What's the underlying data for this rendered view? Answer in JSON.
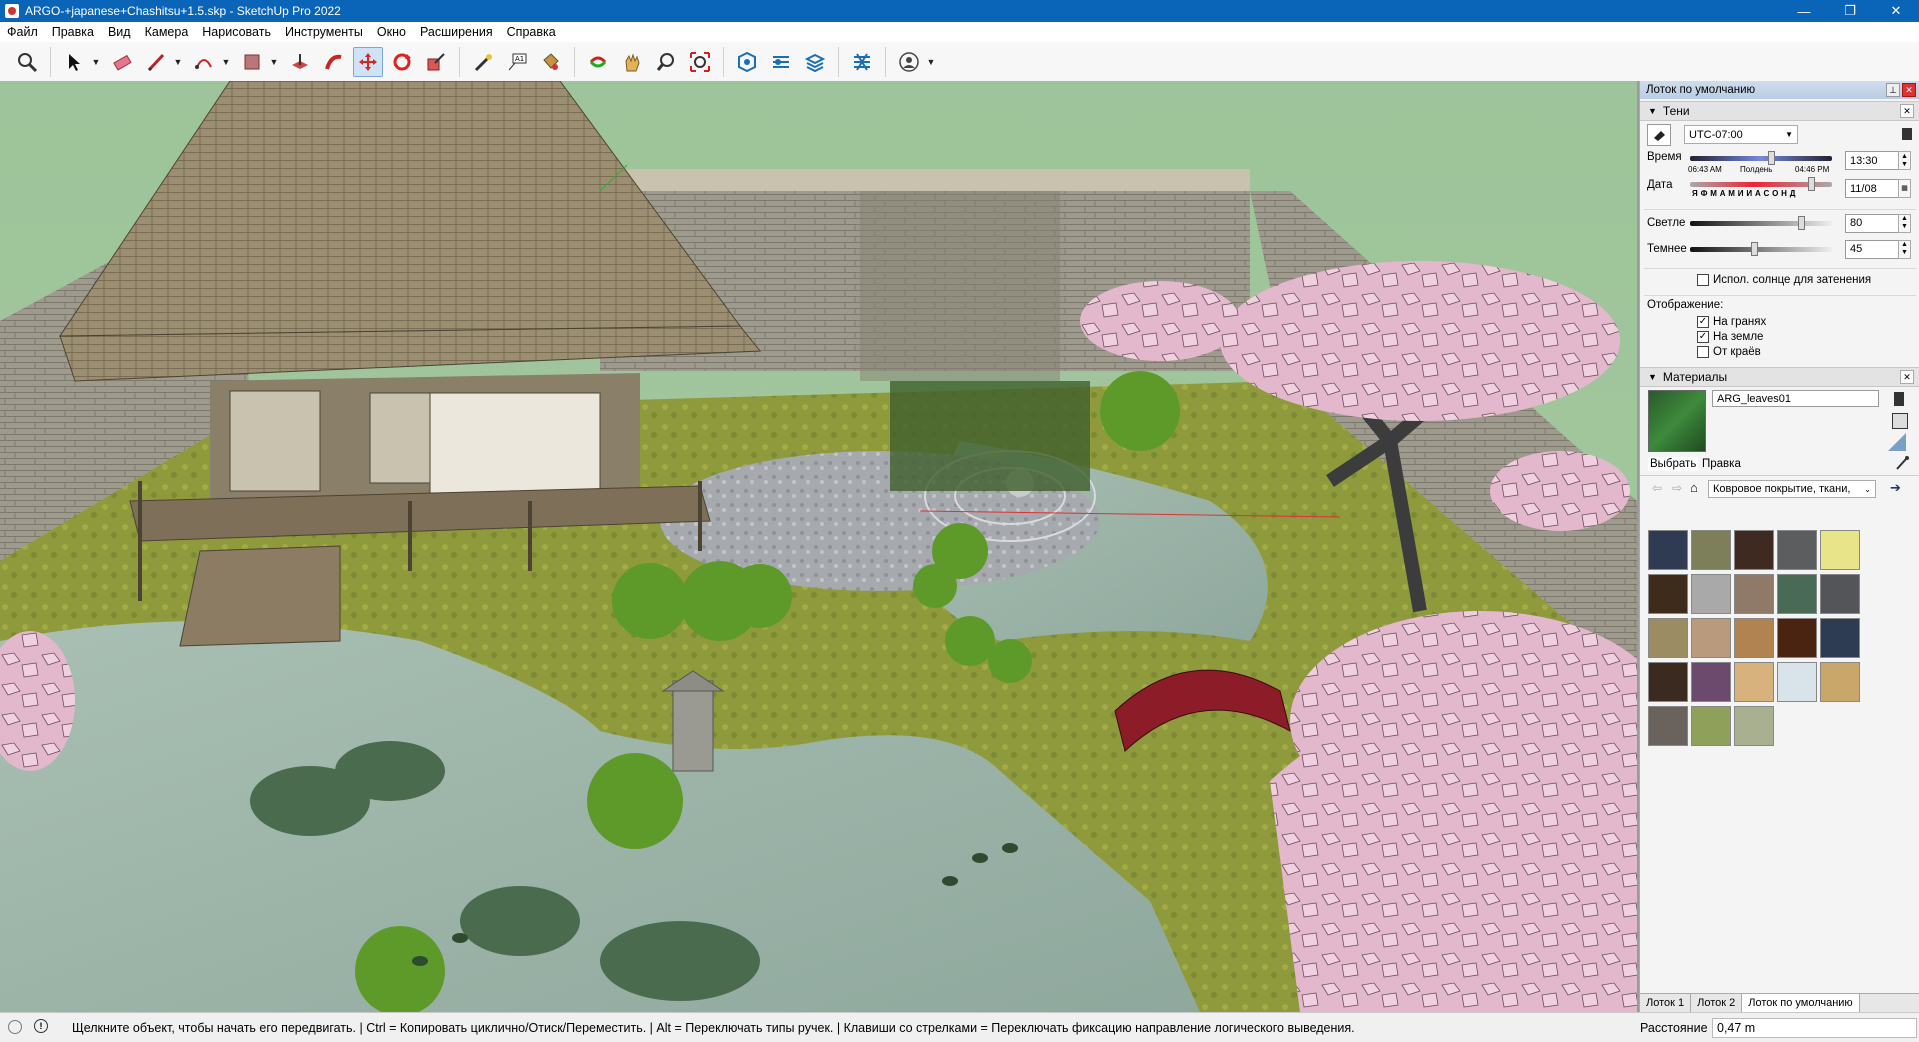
{
  "window": {
    "title": "ARGO-+japanese+Chashitsu+1.5.skp - SketchUp Pro 2022",
    "controls": {
      "minimize": "—",
      "restore": "❐",
      "close": "✕"
    }
  },
  "menu": [
    "Файл",
    "Правка",
    "Вид",
    "Камера",
    "Нарисовать",
    "Инструменты",
    "Окно",
    "Расширения",
    "Справка"
  ],
  "toolbar": {
    "tools": [
      "zoom-icon",
      "select-icon",
      "eraser-icon",
      "pencil-icon",
      "arc-icon",
      "rectangle-icon",
      "push-pull-icon",
      "follow-me-icon",
      "move-icon",
      "rotate-icon",
      "scale-icon",
      "tape-measure-icon",
      "text-icon",
      "paint-bucket-icon",
      "orbit-icon",
      "pan-icon",
      "zoom-tool-icon",
      "zoom-extents-icon",
      "warehouse-icon",
      "extension-warehouse-icon",
      "layout-icon",
      "extension-manager-icon",
      "user-icon"
    ],
    "active_tool": "move-icon"
  },
  "tray": {
    "title": "Лоток по умолчанию",
    "shadows": {
      "title": "Тени",
      "timezone": "UTC-07:00",
      "time_label": "Время",
      "time_marks": [
        "06:43 AM",
        "Полдень",
        "04:46 PM"
      ],
      "time_value": "13:30",
      "date_label": "Дата",
      "month_letters": "Я Ф М А М И И А С О Н Д",
      "date_value": "11/08",
      "light_label": "Светле",
      "light_value": "80",
      "light_level": 0.8,
      "dark_label": "Темнее",
      "dark_value": "45",
      "dark_level": 0.45,
      "use_sun": "Испол. солнце для затенения",
      "use_sun_checked": false,
      "display_label": "Отображение:",
      "on_faces": "На гранях",
      "on_faces_checked": true,
      "on_ground": "На земле",
      "on_ground_checked": true,
      "from_edges": "От краёв",
      "from_edges_checked": false
    },
    "materials": {
      "title": "Материалы",
      "current": "ARG_leaves01",
      "tab_select": "Выбрать",
      "tab_edit": "Правка",
      "library": "Ковровое покрытие, ткани,",
      "swatch_colors": [
        "#2f3b52",
        "#7c7f5a",
        "#3f2a22",
        "#5c5d5e",
        "#e8e48a",
        "#3d2c1c",
        "#a9a9a9",
        "#8f7a69",
        "#4a6a58",
        "#535558",
        "#9c8c64",
        "#b99a7c",
        "#b08350",
        "#4a2410",
        "#2d3b53",
        "#3a2a1f",
        "#6c4a6e",
        "#d7b27c",
        "#d8e4ea",
        "#c9a66a",
        "#6a625c",
        "#8ea05a",
        "#a8b090"
      ]
    },
    "tabs": [
      "Лоток 1",
      "Лоток 2",
      "Лоток по умолчанию"
    ]
  },
  "statusbar": {
    "message": "Щелкните объект, чтобы начать его передвигать. | Ctrl = Копировать циклично/Отиск/Переместить. | Alt = Переключать типы ручек. | Клавиши со стрелками = Переключать фиксацию направление логического выведения.",
    "distance_label": "Расстояние",
    "distance_value": "0,47 m"
  }
}
